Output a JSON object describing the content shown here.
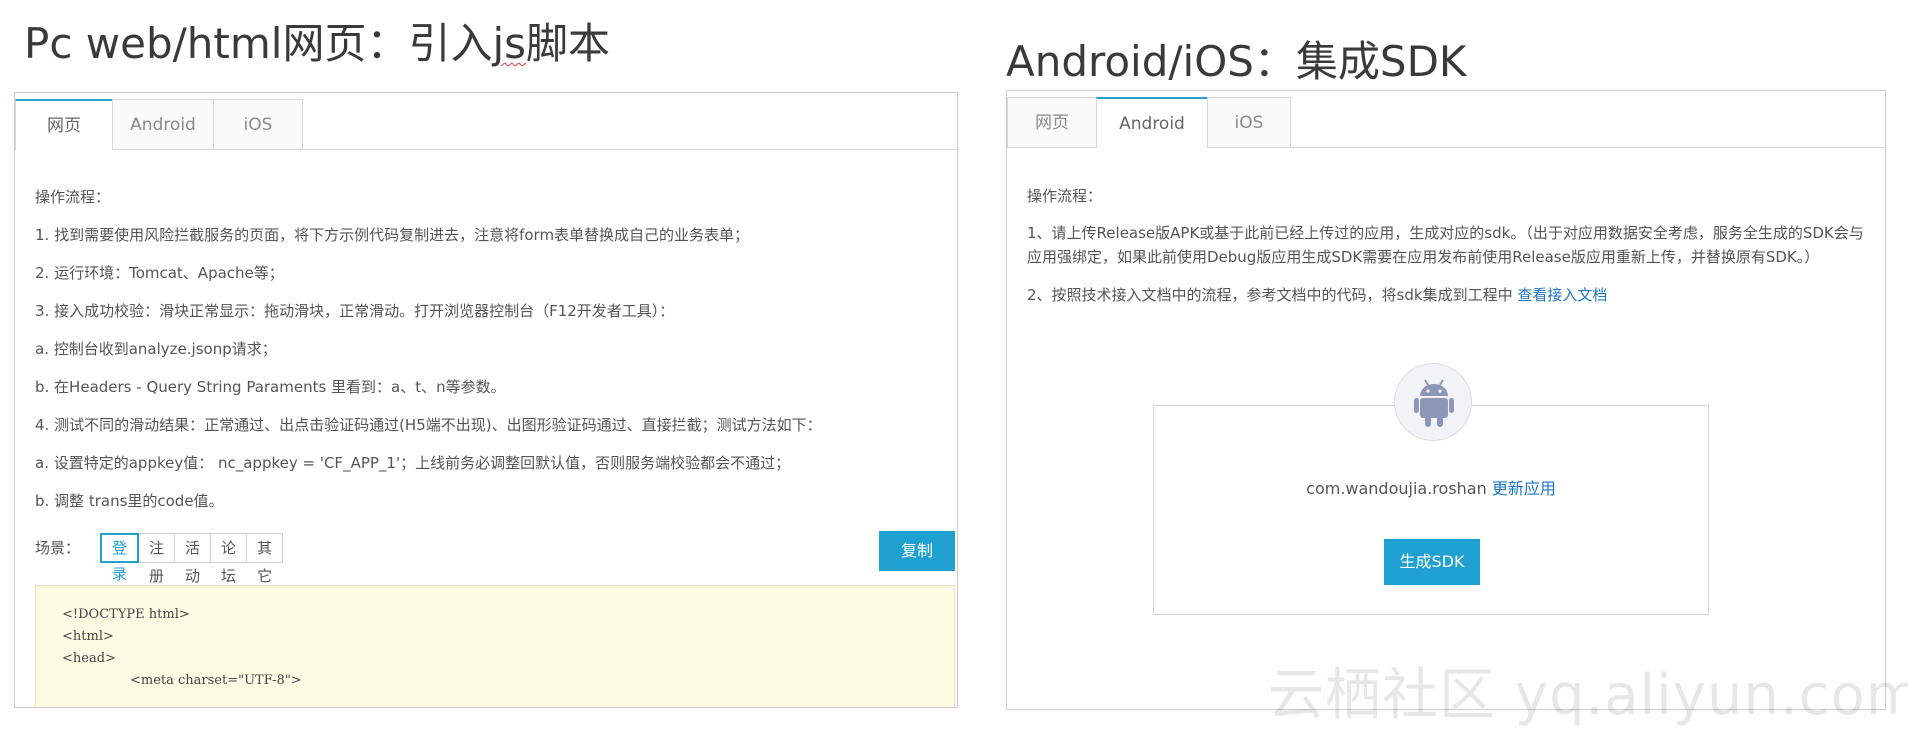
{
  "left": {
    "heading_prefix": "Pc web/html网页：引入",
    "heading_wavy": "js",
    "heading_suffix": "脚本",
    "tabs": [
      "网页",
      "Android",
      "iOS"
    ],
    "active_tab": "网页",
    "steps": [
      "操作流程：",
      "1. 找到需要使用风险拦截服务的页面，将下方示例代码复制进去，注意将form表单替换成自己的业务表单；",
      "2. 运行环境：Tomcat、Apache等；",
      "3. 接入成功校验：滑块正常显示：拖动滑块，正常滑动。打开浏览器控制台（F12开发者工具）：",
      "a. 控制台收到analyze.jsonp请求；",
      "b. 在Headers - Query String Paraments 里看到：a、t、n等参数。",
      "4. 测试不同的滑动结果：正常通过、出点击验证码通过(H5端不出现)、出图形验证码通过、直接拦截；测试方法如下：",
      "a. 设置特定的appkey值： nc_appkey = 'CF_APP_1'；上线前务必调整回默认值，否则服务端校验都会不通过；",
      "b. 调整 trans里的code值。"
    ],
    "scene_label": "场景：",
    "scenes": [
      "登录",
      "注册",
      "活动",
      "论坛",
      "其它"
    ],
    "active_scene": "登录",
    "copy_button": "复制",
    "code_lines": [
      "<!DOCTYPE html>",
      "<html>",
      "<head>",
      "<meta charset=\"UTF-8\">"
    ]
  },
  "right": {
    "heading": "Android/iOS：集成SDK",
    "tabs": [
      "网页",
      "Android",
      "iOS"
    ],
    "active_tab": "Android",
    "steps_title": "操作流程：",
    "step1": "1、请上传Release版APK或基于此前已经上传过的应用，生成对应的sdk。（出于对应用数据安全考虑，服务全生成的SDK会与应用强绑定，如果此前使用Debug版应用生成SDK需要在应用发布前使用Release版应用重新上传，并替换原有SDK。）",
    "step2_text": "2、按照技术接入文档中的流程，参考文档中的代码，将sdk集成到工程中 ",
    "step2_link": "查看接入文档",
    "package_name": "com.wandoujia.roshan",
    "update_link": "更新应用",
    "generate_button": "生成SDK",
    "android_icon": "android-robot-icon"
  },
  "watermark": "云栖社区 yq.aliyun.com",
  "colors": {
    "accent": "#1ea0d0",
    "link": "#1f75c4",
    "code_bg": "#fdfbe3",
    "android_icon": "#8e96b8"
  }
}
